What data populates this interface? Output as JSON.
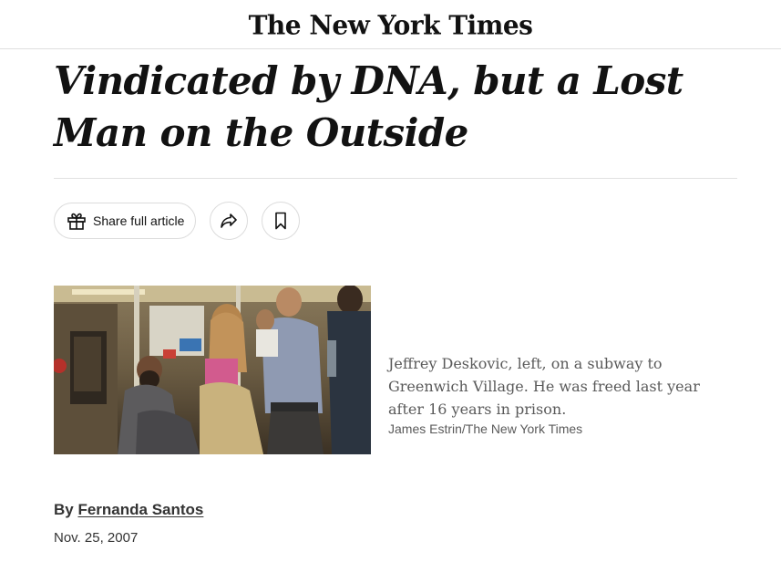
{
  "masthead": {
    "logo_text": "The New York Times"
  },
  "article": {
    "headline": "Vindicated by DNA, but a Lost Man on the Outside"
  },
  "share_bar": {
    "share_label": "Share full article",
    "icons": {
      "gift": "gift-icon",
      "share": "share-arrow-icon",
      "save": "bookmark-icon"
    }
  },
  "figure": {
    "caption": "Jeffrey Deskovic, left, on a subway to Greenwich Village. He was freed last year after 16 years in prison.",
    "credit": "James Estrin/The New York Times"
  },
  "byline": {
    "prefix": "By",
    "author": "Fernanda Santos"
  },
  "dateline": {
    "date": "Nov. 25, 2007"
  },
  "colors": {
    "text": "#121212",
    "muted": "#5a5a5a",
    "border": "#dcdcdc"
  }
}
